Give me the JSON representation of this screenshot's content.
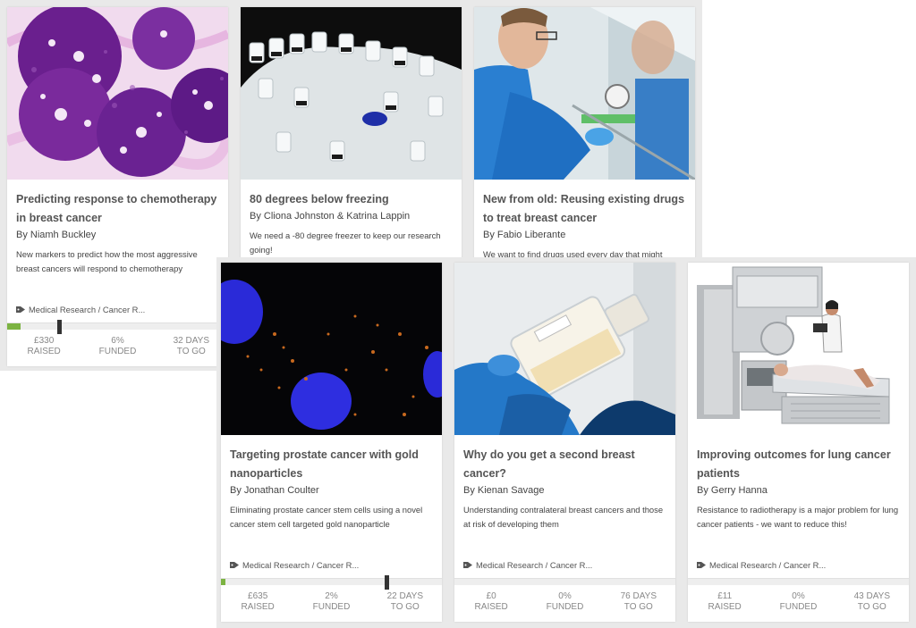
{
  "colors": {
    "progress_fill": "#7cb342",
    "card_bg": "#ffffff",
    "panel_bg": "#e9e9e9"
  },
  "projects": [
    {
      "title": "Predicting response to chemotherapy in breast cancer",
      "author": "By Niamh Buckley",
      "description": "New markers to predict how the most aggressive breast cancers will respond to chemotherapy",
      "tag": "Medical Research / Cancer R...",
      "tag_icon": "tag-icon",
      "funded_fraction": 0.06,
      "stats": {
        "raised": "£330",
        "raised_label": "RAISED",
        "funded": "6%",
        "funded_label": "FUNDED",
        "days": "32 DAYS",
        "days_label": "TO GO"
      }
    },
    {
      "title": "80 degrees below freezing",
      "author": "By Cliona Johnston & Katrina Lappin",
      "description": "We need a -80 degree freezer to keep our research going!"
    },
    {
      "title": "New from old: Reusing existing drugs to treat breast cancer",
      "author": "By Fabio Liberante",
      "description": "We want to find drugs used every day that might"
    },
    {
      "title": "Targeting prostate cancer with gold nanoparticles",
      "author": "By Jonathan Coulter",
      "description": "Eliminating prostate cancer stem cells using a novel cancer stem cell targeted gold nanoparticle",
      "tag": "Medical Research / Cancer R...",
      "tag_icon": "tag-icon",
      "funded_fraction": 0.02,
      "stats": {
        "raised": "£635",
        "raised_label": "RAISED",
        "funded": "2%",
        "funded_label": "FUNDED",
        "days": "22 DAYS",
        "days_label": "TO GO"
      }
    },
    {
      "title": "Why do you get a second breast cancer?",
      "author": "By Kienan Savage",
      "description": "Understanding contralateral breast cancers and those at risk of developing them",
      "tag": "Medical Research / Cancer R...",
      "tag_icon": "tag-icon",
      "funded_fraction": 0,
      "stats": {
        "raised": "£0",
        "raised_label": "RAISED",
        "funded": "0%",
        "funded_label": "FUNDED",
        "days": "76 DAYS",
        "days_label": "TO GO"
      }
    },
    {
      "title": "Improving outcomes for lung cancer patients",
      "author": "By Gerry Hanna",
      "description": "Resistance to radiotherapy is a major problem for lung cancer patients - we want to reduce this!",
      "tag": "Medical Research / Cancer R...",
      "tag_icon": "tag-icon",
      "funded_fraction": 0,
      "stats": {
        "raised": "£11",
        "raised_label": "RAISED",
        "funded": "0%",
        "funded_label": "FUNDED",
        "days": "43 DAYS",
        "days_label": "TO GO"
      }
    }
  ]
}
